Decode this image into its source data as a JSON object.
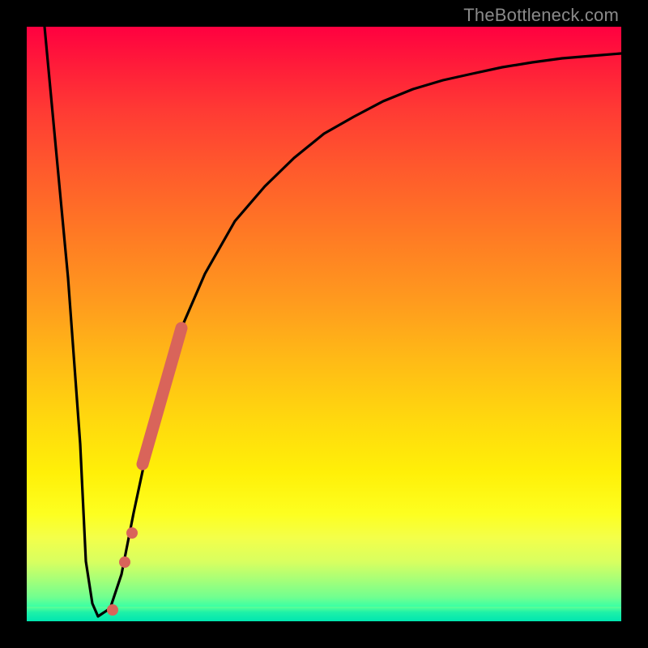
{
  "watermark": {
    "text": "TheBottleneck.com"
  },
  "chart_data": {
    "type": "line",
    "title": "",
    "xlabel": "",
    "ylabel": "",
    "xlim": [
      0,
      100
    ],
    "ylim": [
      0,
      100
    ],
    "series": [
      {
        "name": "bottleneck-curve",
        "x": [
          3,
          5,
          7,
          9,
          10,
          11,
          12,
          14,
          16,
          18,
          20,
          22,
          24,
          26,
          30,
          35,
          40,
          45,
          50,
          55,
          60,
          65,
          70,
          75,
          80,
          85,
          90,
          95,
          100
        ],
        "y": [
          100,
          80,
          58,
          30,
          10,
          3,
          1,
          2,
          8,
          18,
          28,
          36,
          43,
          49,
          58,
          67,
          73,
          78,
          82,
          85,
          87.5,
          89.5,
          91,
          92.2,
          93.2,
          94,
          94.6,
          95.1,
          95.5
        ]
      }
    ],
    "markers": [
      {
        "name": "highlight-segment",
        "x_range": [
          19.5,
          26
        ],
        "y_range": [
          27,
          49
        ]
      },
      {
        "name": "dot-1",
        "x": 17.7,
        "y": 15
      },
      {
        "name": "dot-2",
        "x": 16.5,
        "y": 10
      },
      {
        "name": "dot-3",
        "x": 14.5,
        "y": 2
      }
    ],
    "legend": null,
    "grid": false
  }
}
